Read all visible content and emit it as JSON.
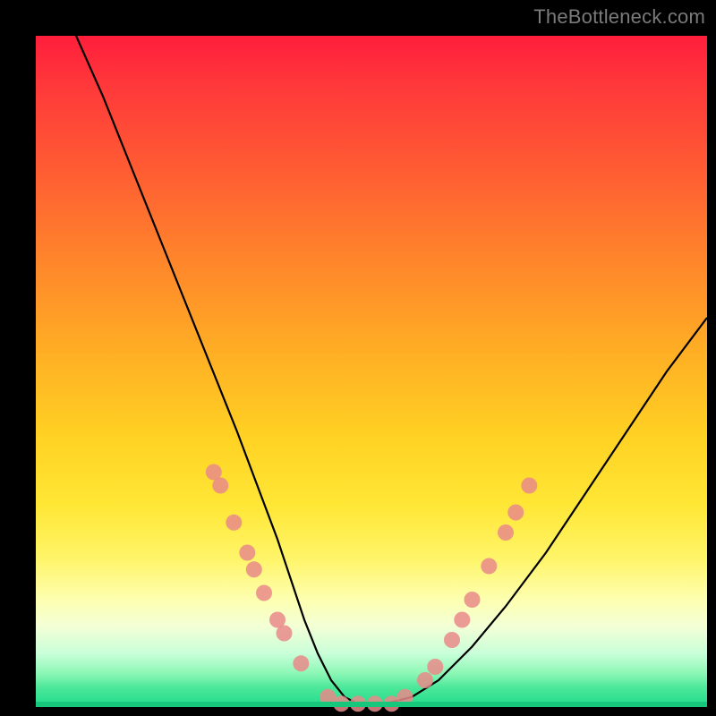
{
  "watermark": "TheBottleneck.com",
  "chart_data": {
    "type": "line",
    "title": "",
    "xlabel": "",
    "ylabel": "",
    "xlim": [
      0,
      100
    ],
    "ylim": [
      0,
      100
    ],
    "grid": false,
    "legend": false,
    "series": [
      {
        "name": "bottleneck-curve",
        "x": [
          6,
          10,
          14,
          18,
          22,
          26,
          30,
          33,
          36,
          38,
          40,
          42,
          44,
          46,
          48,
          52,
          56,
          60,
          65,
          70,
          76,
          82,
          88,
          94,
          100
        ],
        "y": [
          100,
          91,
          81,
          71,
          61,
          51,
          41,
          33,
          25,
          19,
          13,
          8,
          4,
          1.5,
          0.5,
          0.5,
          1.5,
          4,
          9,
          15,
          23,
          32,
          41,
          50,
          58
        ]
      }
    ],
    "markers": [
      {
        "x": 26.5,
        "y": 35
      },
      {
        "x": 27.5,
        "y": 33
      },
      {
        "x": 29.5,
        "y": 27.5
      },
      {
        "x": 31.5,
        "y": 23
      },
      {
        "x": 32.5,
        "y": 20.5
      },
      {
        "x": 34.0,
        "y": 17
      },
      {
        "x": 36.0,
        "y": 13
      },
      {
        "x": 37.0,
        "y": 11
      },
      {
        "x": 39.5,
        "y": 6.5
      },
      {
        "x": 43.5,
        "y": 1.5
      },
      {
        "x": 45.5,
        "y": 0.5
      },
      {
        "x": 48.0,
        "y": 0.5
      },
      {
        "x": 50.5,
        "y": 0.5
      },
      {
        "x": 53.0,
        "y": 0.5
      },
      {
        "x": 55.0,
        "y": 1.5
      },
      {
        "x": 58.0,
        "y": 4
      },
      {
        "x": 59.5,
        "y": 6
      },
      {
        "x": 62.0,
        "y": 10
      },
      {
        "x": 63.5,
        "y": 13
      },
      {
        "x": 65.0,
        "y": 16
      },
      {
        "x": 67.5,
        "y": 21
      },
      {
        "x": 70.0,
        "y": 26
      },
      {
        "x": 71.5,
        "y": 29
      },
      {
        "x": 73.5,
        "y": 33
      }
    ],
    "marker_color": "#e98a8a",
    "curve_color": "#000000"
  }
}
